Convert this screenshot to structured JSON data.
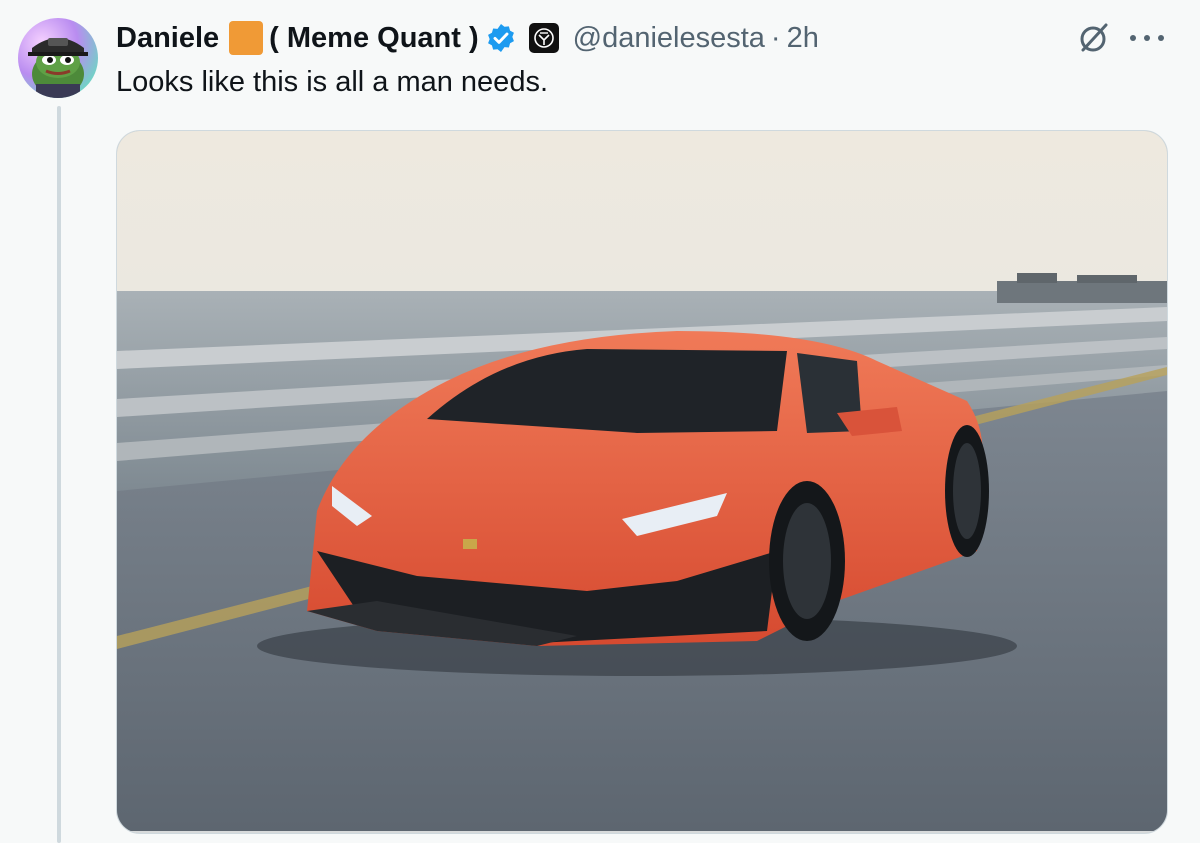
{
  "author": {
    "name": "Daniele",
    "name_suffix": "( Meme Quant )",
    "handle": "@danielesesta",
    "separator": "·",
    "time": "2h",
    "verified": true
  },
  "tweet": {
    "text": "Looks like this is all a man needs."
  },
  "icons": {
    "avatar": "pepe-avatar",
    "verified": "verified-badge-icon",
    "affiliate": "affiliate-badge-icon",
    "grok": "grok-icon",
    "more": "more-icon"
  },
  "colors": {
    "accent": "#1d9bf0",
    "secondary_text": "#536471",
    "badge_orange": "#f09a36",
    "car": "#e0553a"
  }
}
